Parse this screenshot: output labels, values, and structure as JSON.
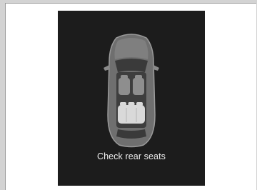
{
  "display": {
    "message": "Check rear seats",
    "icon": "car-top-view-rear-seats-highlighted-icon",
    "colors": {
      "background": "#d3d3d3",
      "screen": "#1c1c1c",
      "text": "#ececec",
      "rear_seat_highlight": "#d9d9d9"
    }
  }
}
